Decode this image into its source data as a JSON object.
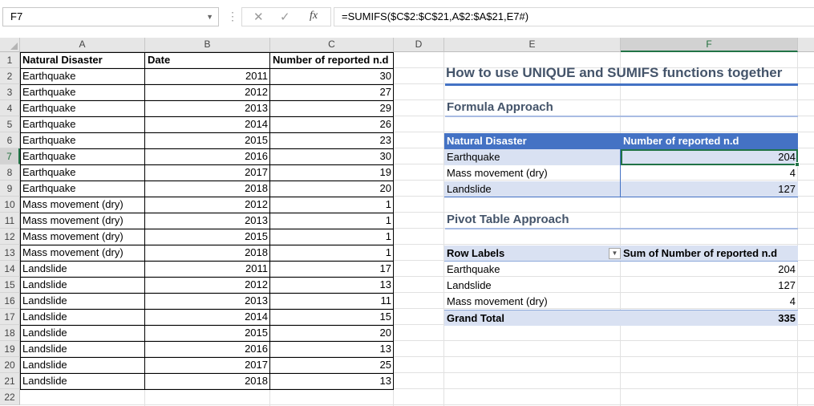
{
  "formula_bar": {
    "name_box": "F7",
    "cancel_icon": "✕",
    "enter_icon": "✓",
    "fx_label": "fx",
    "formula": "=SUMIFS($C$2:$C$21,A$2:$A$21,E7#)"
  },
  "columns": [
    "A",
    "B",
    "C",
    "D",
    "E",
    "F"
  ],
  "selected_column": "F",
  "selected_row": "7",
  "rows": [
    "1",
    "2",
    "3",
    "4",
    "5",
    "6",
    "7",
    "8",
    "9",
    "10",
    "11",
    "12",
    "13",
    "14",
    "15",
    "16",
    "17",
    "18",
    "19",
    "20",
    "21",
    "22"
  ],
  "source_table": {
    "headers": [
      "Natural Disaster",
      "Date",
      "Number of reported n.d"
    ],
    "rows": [
      [
        "Earthquake",
        "2011",
        "30"
      ],
      [
        "Earthquake",
        "2012",
        "27"
      ],
      [
        "Earthquake",
        "2013",
        "29"
      ],
      [
        "Earthquake",
        "2014",
        "26"
      ],
      [
        "Earthquake",
        "2015",
        "23"
      ],
      [
        "Earthquake",
        "2016",
        "30"
      ],
      [
        "Earthquake",
        "2017",
        "19"
      ],
      [
        "Earthquake",
        "2018",
        "20"
      ],
      [
        "Mass movement (dry)",
        "2012",
        "1"
      ],
      [
        "Mass movement (dry)",
        "2013",
        "1"
      ],
      [
        "Mass movement (dry)",
        "2015",
        "1"
      ],
      [
        "Mass movement (dry)",
        "2018",
        "1"
      ],
      [
        "Landslide",
        "2011",
        "17"
      ],
      [
        "Landslide",
        "2012",
        "13"
      ],
      [
        "Landslide",
        "2013",
        "11"
      ],
      [
        "Landslide",
        "2014",
        "15"
      ],
      [
        "Landslide",
        "2015",
        "20"
      ],
      [
        "Landslide",
        "2016",
        "13"
      ],
      [
        "Landslide",
        "2017",
        "25"
      ],
      [
        "Landslide",
        "2018",
        "13"
      ]
    ]
  },
  "title": "How to use UNIQUE and SUMIFS functions together",
  "formula_section": {
    "heading": "Formula Approach",
    "headers": [
      "Natural Disaster",
      "Number of reported n.d"
    ],
    "rows": [
      [
        "Earthquake",
        "204"
      ],
      [
        "Mass movement (dry)",
        "4"
      ],
      [
        "Landslide",
        "127"
      ]
    ]
  },
  "pivot_section": {
    "heading": "Pivot Table Approach",
    "headers": [
      "Row Labels",
      "Sum of Number of reported n.d"
    ],
    "filter_icon": "▼",
    "rows": [
      [
        "Earthquake",
        "204"
      ],
      [
        "Landslide",
        "127"
      ],
      [
        "Mass movement (dry)",
        "4"
      ]
    ],
    "total": [
      "Grand Total",
      "335"
    ]
  },
  "colors": {
    "accent": "#217346",
    "table_header": "#4472c4",
    "band": "#d9e1f2",
    "title": "#44546a"
  }
}
